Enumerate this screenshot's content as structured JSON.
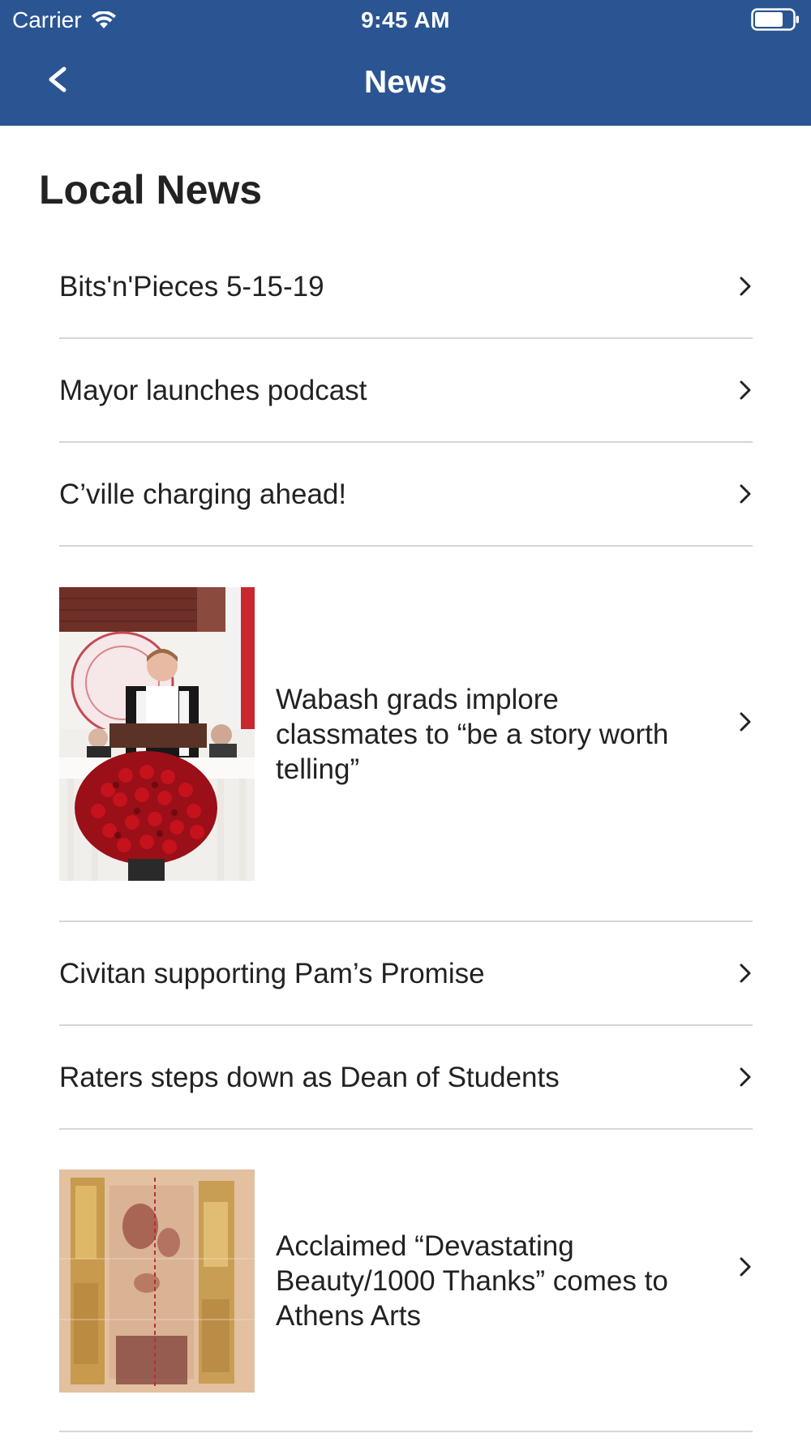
{
  "status_bar": {
    "carrier": "Carrier",
    "time": "9:45 AM",
    "wifi_icon": "wifi-icon",
    "battery_icon": "battery-icon"
  },
  "nav": {
    "back_label": "<",
    "title": "News"
  },
  "section": {
    "title": "Local News"
  },
  "news_items": [
    {
      "title": "Bits'n'Pieces 5-15-19"
    },
    {
      "title": "Mayor launches podcast"
    },
    {
      "title": "C’ville charging ahead!"
    },
    {
      "title": "Wabash grads implore classmates to “be a story worth telling”"
    },
    {
      "title": "Civitan supporting Pam’s Promise"
    },
    {
      "title": "Raters steps down as Dean of Students"
    },
    {
      "title": "Acclaimed “Devastating Beauty/1000 Thanks” comes to Athens Arts"
    }
  ],
  "colors": {
    "nav_background": "#2b5592",
    "nav_text": "#ffffff",
    "divider": "#d6d6d6",
    "text": "#222222"
  }
}
